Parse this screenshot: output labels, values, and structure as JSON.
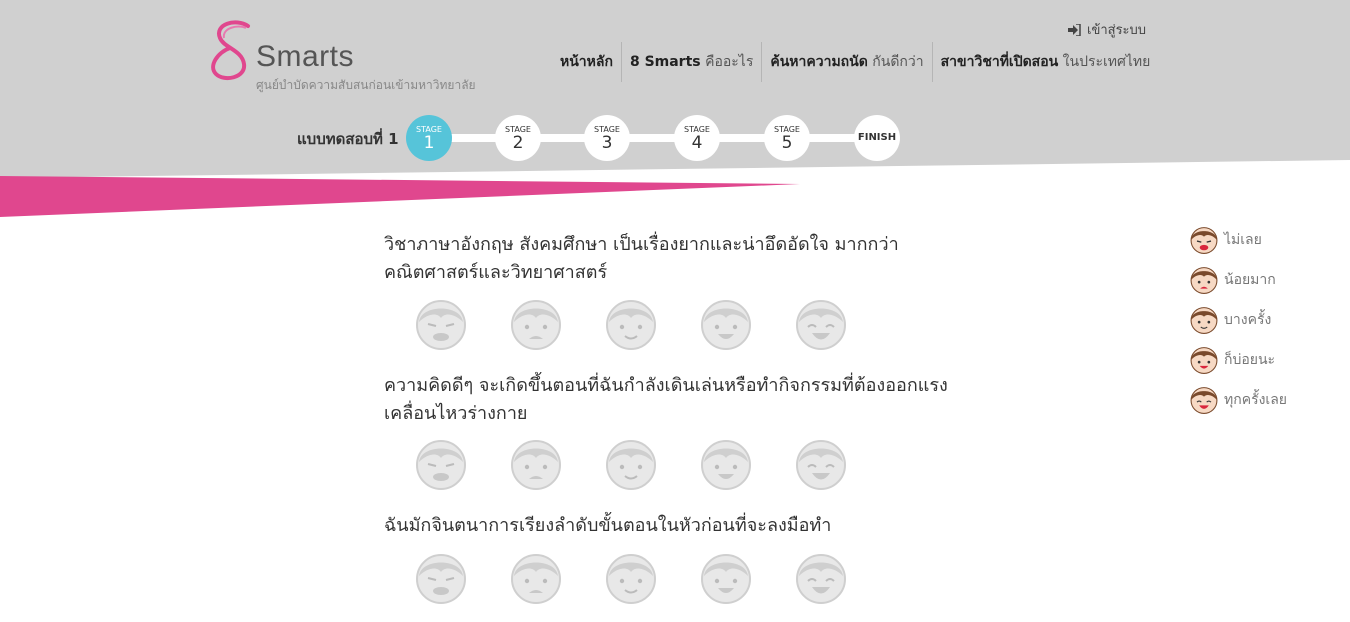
{
  "brand": {
    "name": "Smarts",
    "subtitle": "ศูนย์บำบัดความสับสนก่อนเข้ามหาวิทยาลัย"
  },
  "login": {
    "label": "เข้าสู่ระบบ",
    "icon": "sign-in-icon"
  },
  "nav": [
    {
      "bold": "หน้าหลัก",
      "light": ""
    },
    {
      "bold": "8 Smarts",
      "light": "คืออะไร"
    },
    {
      "bold": "ค้นหาความถนัด",
      "light": "กันดีกว่า"
    },
    {
      "bold": "สาขาวิชาที่เปิดสอน",
      "light": "ในประเทศไทย"
    }
  ],
  "test": {
    "label": "แบบทดสอบที่ 1",
    "stages": [
      {
        "title": "STAGE",
        "num": "1",
        "active": true
      },
      {
        "title": "STAGE",
        "num": "2",
        "active": false
      },
      {
        "title": "STAGE",
        "num": "3",
        "active": false
      },
      {
        "title": "STAGE",
        "num": "4",
        "active": false
      },
      {
        "title": "STAGE",
        "num": "5",
        "active": false
      },
      {
        "title": "",
        "num": "FINISH",
        "active": false
      }
    ]
  },
  "questions": [
    {
      "text": "วิชาภาษาอังกฤษ สังคมศึกษา เป็นเรื่องยากและน่าอึดอัดใจ มากกว่าคณิตศาสตร์และวิทยาศาสตร์"
    },
    {
      "text": "ความคิดดีๆ จะเกิดขึ้นตอนที่ฉันกำลังเดินเล่นหรือทำกิจกรรมที่ต้องออกแรงเคลื่อนไหวร่างกาย"
    },
    {
      "text": "ฉันมักจินตนาการเรียงลำดับขั้นตอนในหัวก่อนที่จะลงมือทำ"
    }
  ],
  "legend": [
    {
      "label": "ไม่เลย",
      "icon": "crying-face-icon"
    },
    {
      "label": "น้อยมาก",
      "icon": "sad-face-icon"
    },
    {
      "label": "บางครั้ง",
      "icon": "neutral-face-icon"
    },
    {
      "label": "ก็บ่อยนะ",
      "icon": "smile-face-icon"
    },
    {
      "label": "ทุกครั้งเลย",
      "icon": "laugh-face-icon"
    }
  ],
  "colors": {
    "header_bg": "#d0d0d0",
    "accent_pink": "#e0478e",
    "active_stage": "#56c4d9",
    "face_gray": "#cccccc",
    "face_hair": "#7a4a2c"
  }
}
